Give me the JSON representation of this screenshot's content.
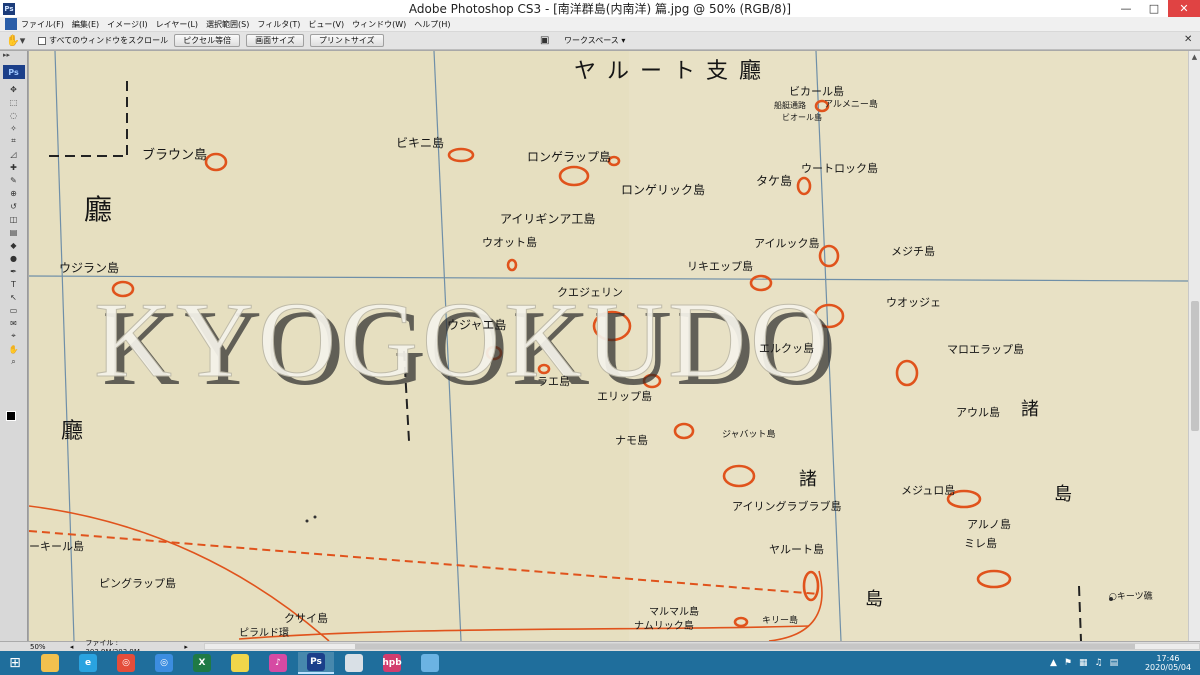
{
  "window": {
    "title": "Adobe Photoshop CS3 - [南洋群島(内南洋) 篇.jpg @ 50% (RGB/8)]",
    "app_icon": "Ps",
    "minimize_label": "—",
    "maximize_label": "□",
    "close_label": "✕"
  },
  "menu": {
    "items": [
      "ファイル(F)",
      "編集(E)",
      "イメージ(I)",
      "レイヤー(L)",
      "選択範囲(S)",
      "フィルタ(T)",
      "ビュー(V)",
      "ウィンドウ(W)",
      "ヘルプ(H)"
    ]
  },
  "options": {
    "scroll_all_label": "すべてのウィンドウをスクロール",
    "buttons": [
      "ピクセル等倍",
      "画面サイズ",
      "プリントサイズ"
    ],
    "workspace_label": "ワークスペース ▾"
  },
  "tools": {
    "badge": "Ps",
    "icons": [
      "move-icon",
      "marquee-icon",
      "lasso-icon",
      "magic-wand-icon",
      "crop-icon",
      "slice-icon",
      "healing-icon",
      "brush-icon",
      "stamp-icon",
      "history-brush-icon",
      "eraser-icon",
      "gradient-icon",
      "blur-icon",
      "dodge-icon",
      "pen-icon",
      "type-icon",
      "path-select-icon",
      "shape-icon",
      "notes-icon",
      "eyedropper-icon",
      "hand-icon",
      "zoom-icon"
    ]
  },
  "map": {
    "watermark": "KYOGOKUDO",
    "big_labels": {
      "yaruto_shicho": "ヤ ル ー ト 支 廳",
      "cho_left_top": "廳",
      "cho_left_mid": "廳",
      "shotou_1": "諸",
      "shotou_2": "島",
      "shotou_3": "諸",
      "shotou_4": "島"
    },
    "labels": {
      "bikaru": "ビカール島",
      "armeni": "アルメニー島",
      "senkyo": "船艇通路",
      "biooru": "ビオール島",
      "utorokku": "ウートロック島",
      "take": "タケ島",
      "buraun": "ブラウン島",
      "bikini": "ビキニ島",
      "rongerappu": "ロンゲラップ島",
      "rongerikku": "ロンゲリック島",
      "airikingia": "アイリギンア工島",
      "wottsuto": "ウオット島",
      "airukku": "アイルック島",
      "mejichi": "メジチ島",
      "rikieppu": "リキエップ島",
      "ujiran": "ウジラン島",
      "kuejerin": "クエジェリン",
      "ujae": "ウジャエ島",
      "rae": "ラエ島",
      "erikku": "エルクッ島",
      "wottsuje": "ウオッジェ",
      "maroerappu": "マロエラップ島",
      "auru": "アウル島",
      "erippu": "エリップ島",
      "namo": "ナモ島",
      "jabatto": "ジャバット島",
      "airinglap": "アイリングラブラブ島",
      "mejuro": "メジュロ島",
      "aruno": "アルノ島",
      "mire": "ミレ島",
      "kiiru": "ーキール島",
      "pingelap": "ピングラップ島",
      "kusai": "クサイ島",
      "pirarudo": "ピラルド環",
      "yaruto": "ヤルート島",
      "marumaru": "マルマル島",
      "namurikku": "ナムリック島",
      "kiri": "キリー島",
      "kitsu": "○キーツ礁"
    }
  },
  "status": {
    "zoom": "50%",
    "file_info": "ファイル : 303.9M/303.9M",
    "arrow_left": "◂",
    "arrow_right": "▸"
  },
  "taskbar": {
    "start_icon": "⊞",
    "apps": [
      "explorer-icon",
      "ie-icon",
      "chrome-icon",
      "chrome-alt-icon",
      "excel-icon",
      "photos-icon",
      "itunes-icon",
      "photoshop-icon",
      "paint-icon",
      "hpb-icon",
      "app-icon"
    ],
    "app_glyphs": [
      "",
      "e",
      "◎",
      "◎",
      "X",
      "",
      "♪",
      "Ps",
      "",
      "hpb",
      ""
    ],
    "app_colors": [
      "#f2c14e",
      "#2aa3e0",
      "#e44d3a",
      "#3c8de0",
      "#1f7a45",
      "#f1d64a",
      "#d64aa3",
      "#1b3f8a",
      "#d9e0e6",
      "#d23c6e",
      "#6bb3e3"
    ],
    "clock_time": "17:46",
    "clock_date": "2020/05/04"
  },
  "colors": {
    "map_paper": "#e8e1c4",
    "map_red": "#e0531c",
    "map_line": "#6f8fa8",
    "taskbar": "#1f6e9c"
  }
}
